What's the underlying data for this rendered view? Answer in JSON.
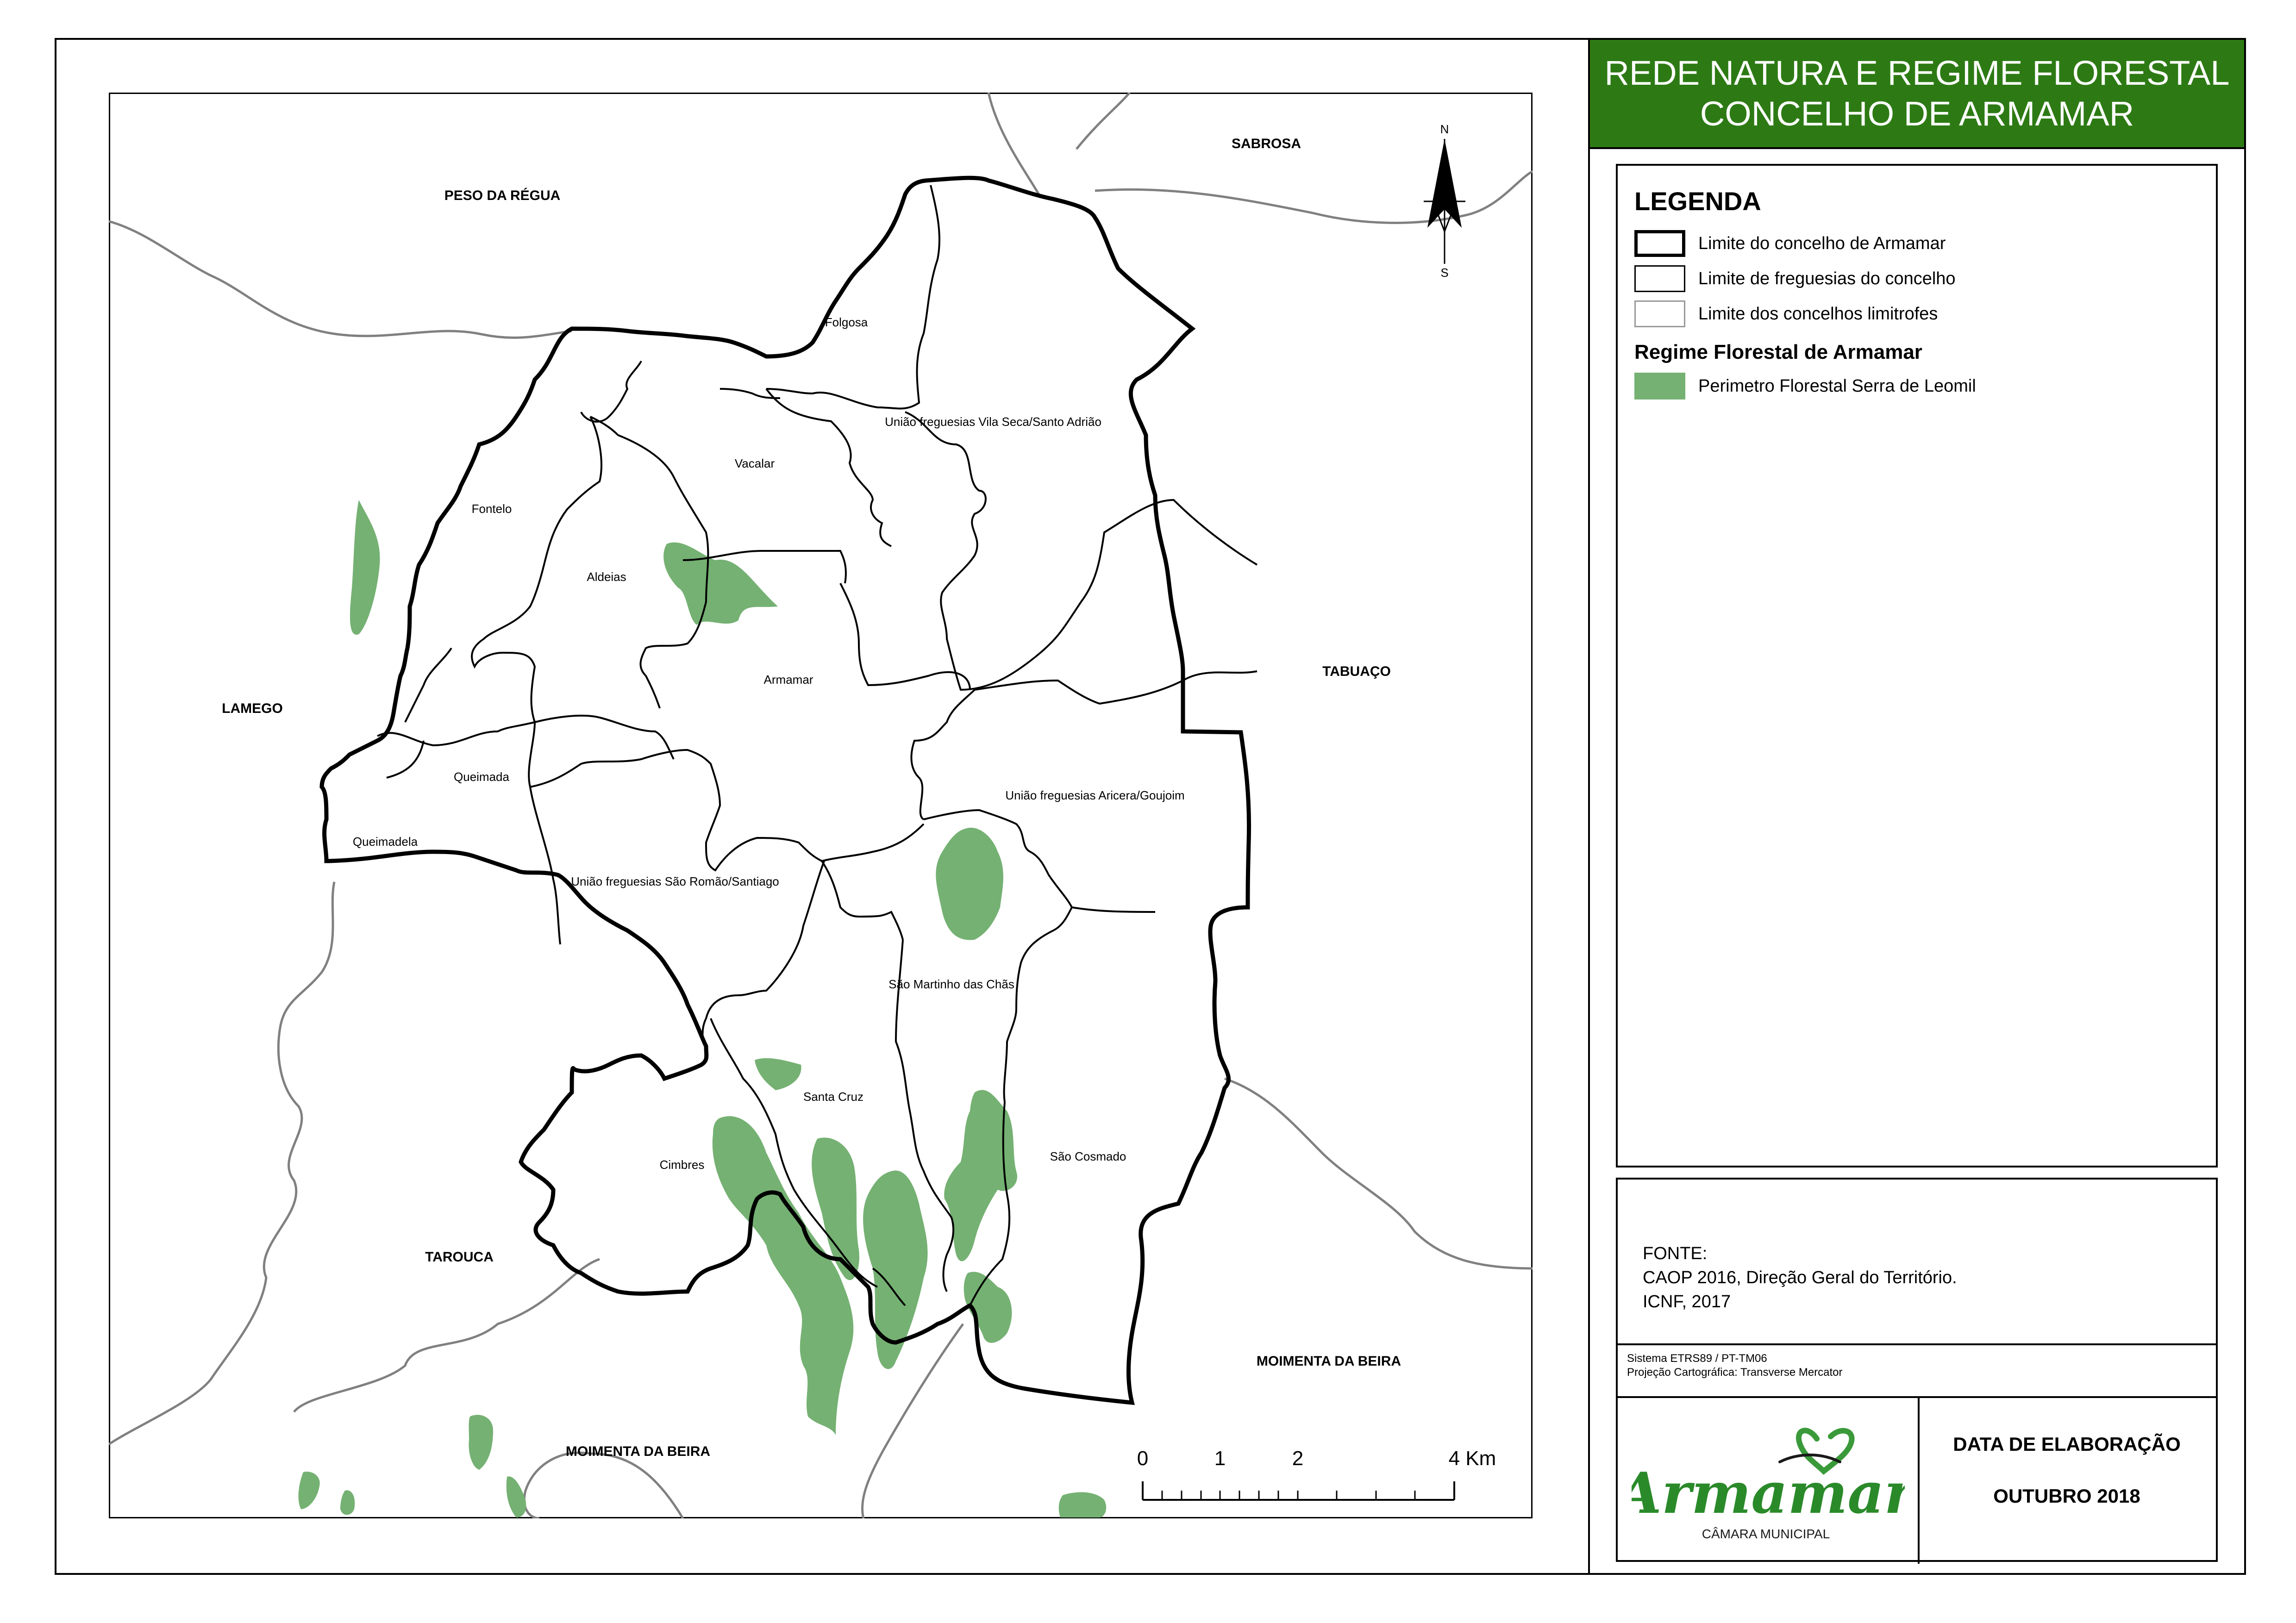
{
  "title": {
    "line1": "REDE NATURA E REGIME FLORESTAL",
    "line2": "CONCELHO DE ARMAMAR"
  },
  "colors": {
    "title_bg": "#2d7a14",
    "forest_green": "#75b173",
    "neighbour_border": "#808080"
  },
  "legend": {
    "heading": "LEGENDA",
    "items": [
      {
        "label": "Limite do concelho de Armamar"
      },
      {
        "label": "Limite de freguesias do concelho"
      },
      {
        "label": "Limite dos concelhos limitrofes"
      }
    ],
    "subheading": "Regime Florestal de Armamar",
    "forest_item": {
      "label": "Perimetro Florestal Serra de Leomil"
    }
  },
  "neighbours": {
    "peso_da_regua": "PESO DA RÉGUA",
    "sabrosa": "SABROSA",
    "lamego": "LAMEGO",
    "tabuaco": "TABUAÇO",
    "tarouca": "TAROUCA",
    "moimenta_east": "MOIMENTA DA BEIRA",
    "moimenta_south": "MOIMENTA DA BEIRA"
  },
  "parishes": {
    "folgosa": "Folgosa",
    "vila_seca": "União freguesias Vila Seca/Santo Adrião",
    "vacalar": "Vacalar",
    "fontelo": "Fontelo",
    "aldeias": "Aldeias",
    "armamar": "Armamar",
    "queimada": "Queimada",
    "queimadela": "Queimadela",
    "aricera": "União freguesias Aricera/Goujoim",
    "sao_romao": "União freguesias São Romão/Santiago",
    "sao_martinho": "São Martinho das Chãs",
    "santa_cruz": "Santa Cruz",
    "cimbres": "Cimbres",
    "sao_cosmado": "São Cosmado"
  },
  "north_arrow": {
    "north": "N",
    "south": "S"
  },
  "scale_bar": {
    "ticks": [
      "0",
      "1",
      "2",
      "4 Km"
    ]
  },
  "source": {
    "heading": "FONTE:",
    "line1": "CAOP 2016, Direção Geral do Território.",
    "line2": "ICNF, 2017"
  },
  "projection": {
    "line1": "Sistema ETRS89 / PT-TM06",
    "line2": "Projeção Cartográfica: Transverse Mercator"
  },
  "logo": {
    "wordmark": "Armamar",
    "tagline": "CÂMARA MUNICIPAL"
  },
  "date": {
    "label": "DATA DE ELABORAÇÃO",
    "value": "OUTUBRO 2018"
  }
}
